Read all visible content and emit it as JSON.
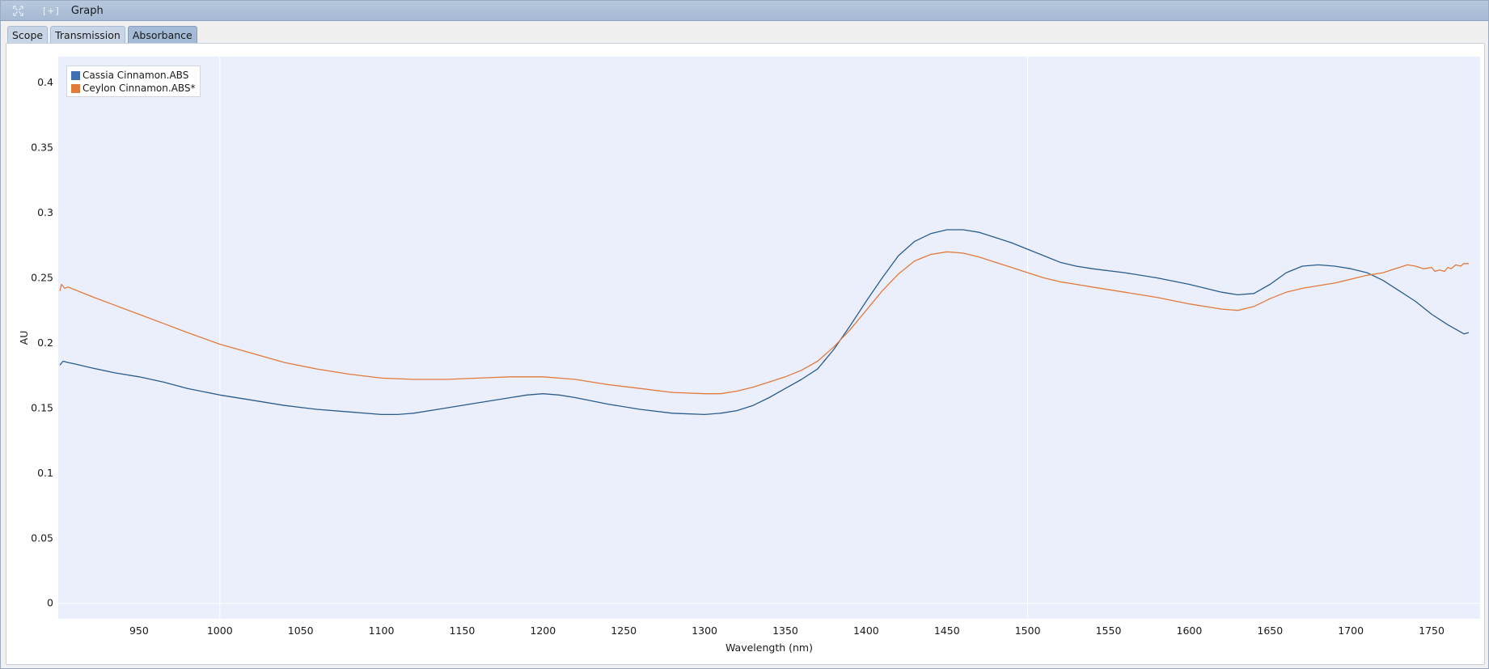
{
  "window": {
    "title": "Graph",
    "restore_label": "[+]",
    "icon": "fit-view-icon"
  },
  "tabs": [
    {
      "label": "Scope",
      "active": false
    },
    {
      "label": "Transmission",
      "active": false
    },
    {
      "label": "Absorbance",
      "active": true
    }
  ],
  "chart_data": {
    "type": "line",
    "xlabel": "Wavelength (nm)",
    "ylabel": "AU",
    "xlim": [
      900,
      1780
    ],
    "ylim": [
      -0.012,
      0.42
    ],
    "xticks": [
      950,
      1000,
      1050,
      1100,
      1150,
      1200,
      1250,
      1300,
      1350,
      1400,
      1450,
      1500,
      1550,
      1600,
      1650,
      1700,
      1750
    ],
    "yticks": [
      0,
      0.05,
      0.1,
      0.15,
      0.2,
      0.25,
      0.3,
      0.35,
      0.4
    ],
    "grid": true,
    "legend_position": "top-left",
    "series": [
      {
        "name": "Cassia Cinnamon.ABS",
        "color": "#2a5c8c",
        "x": [
          901,
          903,
          906,
          910,
          920,
          935,
          950,
          965,
          980,
          1000,
          1020,
          1040,
          1060,
          1080,
          1100,
          1110,
          1120,
          1140,
          1160,
          1180,
          1190,
          1200,
          1210,
          1220,
          1240,
          1260,
          1280,
          1300,
          1310,
          1320,
          1330,
          1340,
          1350,
          1360,
          1370,
          1380,
          1390,
          1400,
          1410,
          1420,
          1430,
          1440,
          1450,
          1460,
          1470,
          1480,
          1490,
          1500,
          1510,
          1520,
          1530,
          1540,
          1560,
          1580,
          1600,
          1620,
          1630,
          1640,
          1650,
          1660,
          1670,
          1680,
          1690,
          1700,
          1710,
          1720,
          1730,
          1740,
          1750,
          1760,
          1770,
          1773
        ],
        "values": [
          0.183,
          0.186,
          0.185,
          0.184,
          0.181,
          0.177,
          0.174,
          0.17,
          0.165,
          0.16,
          0.156,
          0.152,
          0.149,
          0.147,
          0.145,
          0.145,
          0.146,
          0.15,
          0.154,
          0.158,
          0.16,
          0.161,
          0.16,
          0.158,
          0.153,
          0.149,
          0.146,
          0.145,
          0.146,
          0.148,
          0.152,
          0.158,
          0.165,
          0.172,
          0.18,
          0.195,
          0.213,
          0.232,
          0.25,
          0.267,
          0.278,
          0.284,
          0.287,
          0.287,
          0.285,
          0.281,
          0.277,
          0.272,
          0.267,
          0.262,
          0.259,
          0.257,
          0.254,
          0.25,
          0.245,
          0.239,
          0.237,
          0.238,
          0.245,
          0.254,
          0.259,
          0.26,
          0.259,
          0.257,
          0.254,
          0.248,
          0.24,
          0.232,
          0.222,
          0.214,
          0.207,
          0.208
        ]
      },
      {
        "name": "Ceylon Cinnamon.ABS*",
        "color": "#e07b3c",
        "x": [
          901,
          902,
          904,
          906,
          910,
          920,
          935,
          950,
          965,
          980,
          1000,
          1020,
          1040,
          1060,
          1080,
          1100,
          1120,
          1140,
          1160,
          1180,
          1200,
          1210,
          1220,
          1240,
          1260,
          1280,
          1300,
          1310,
          1320,
          1330,
          1340,
          1350,
          1360,
          1370,
          1380,
          1390,
          1400,
          1410,
          1420,
          1430,
          1440,
          1450,
          1460,
          1470,
          1480,
          1490,
          1500,
          1510,
          1520,
          1530,
          1540,
          1560,
          1580,
          1600,
          1620,
          1630,
          1640,
          1650,
          1660,
          1670,
          1680,
          1690,
          1700,
          1710,
          1720,
          1725,
          1730,
          1735,
          1740,
          1745,
          1750,
          1752,
          1755,
          1758,
          1760,
          1762,
          1765,
          1768,
          1770,
          1773
        ],
        "values": [
          0.24,
          0.245,
          0.242,
          0.243,
          0.241,
          0.236,
          0.229,
          0.222,
          0.215,
          0.208,
          0.199,
          0.192,
          0.185,
          0.18,
          0.176,
          0.173,
          0.172,
          0.172,
          0.173,
          0.174,
          0.174,
          0.173,
          0.172,
          0.168,
          0.165,
          0.162,
          0.161,
          0.161,
          0.163,
          0.166,
          0.17,
          0.174,
          0.179,
          0.186,
          0.197,
          0.21,
          0.225,
          0.24,
          0.253,
          0.263,
          0.268,
          0.27,
          0.269,
          0.266,
          0.262,
          0.258,
          0.254,
          0.25,
          0.247,
          0.245,
          0.243,
          0.239,
          0.235,
          0.23,
          0.226,
          0.225,
          0.228,
          0.234,
          0.239,
          0.242,
          0.244,
          0.246,
          0.249,
          0.252,
          0.254,
          0.256,
          0.258,
          0.26,
          0.259,
          0.257,
          0.258,
          0.255,
          0.256,
          0.255,
          0.258,
          0.257,
          0.26,
          0.259,
          0.261,
          0.261
        ]
      }
    ]
  }
}
